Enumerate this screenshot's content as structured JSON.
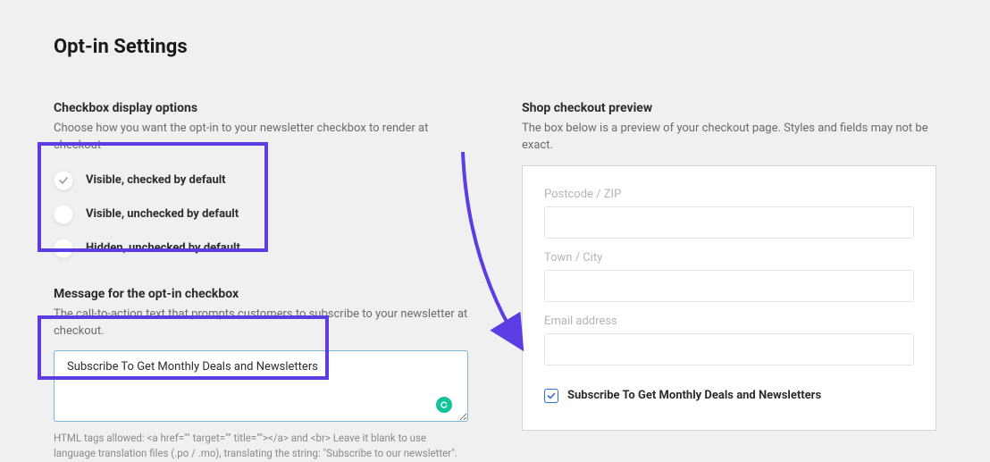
{
  "page": {
    "title": "Opt-in Settings"
  },
  "display_options": {
    "title": "Checkbox display options",
    "subtitle": "Choose how you want the opt-in to your newsletter checkbox to render at checkout",
    "items": [
      {
        "label": "Visible, checked by default",
        "selected": true
      },
      {
        "label": "Visible, unchecked by default",
        "selected": false
      },
      {
        "label": "Hidden, unchecked by default",
        "selected": false
      }
    ]
  },
  "message": {
    "title": "Message for the opt-in checkbox",
    "subtitle": "The call-to-action text that prompts customers to subscribe to your newsletter at checkout.",
    "value": "Subscribe To Get Monthly Deals and Newsletters",
    "helper": "HTML tags allowed: <a href=\"\" target=\"\" title=\"\"></a> and <br>\nLeave it blank to use language translation files (.po / .mo), translating the string: \"Subscribe to our newsletter\"."
  },
  "preview": {
    "title": "Shop checkout preview",
    "subtitle": "The box below is a preview of your checkout page. Styles and fields may not be exact.",
    "fields": [
      {
        "label": "Postcode / ZIP"
      },
      {
        "label": "Town / City"
      },
      {
        "label": "Email address"
      }
    ],
    "checkbox_label": "Subscribe To Get Monthly Deals and Newsletters"
  }
}
